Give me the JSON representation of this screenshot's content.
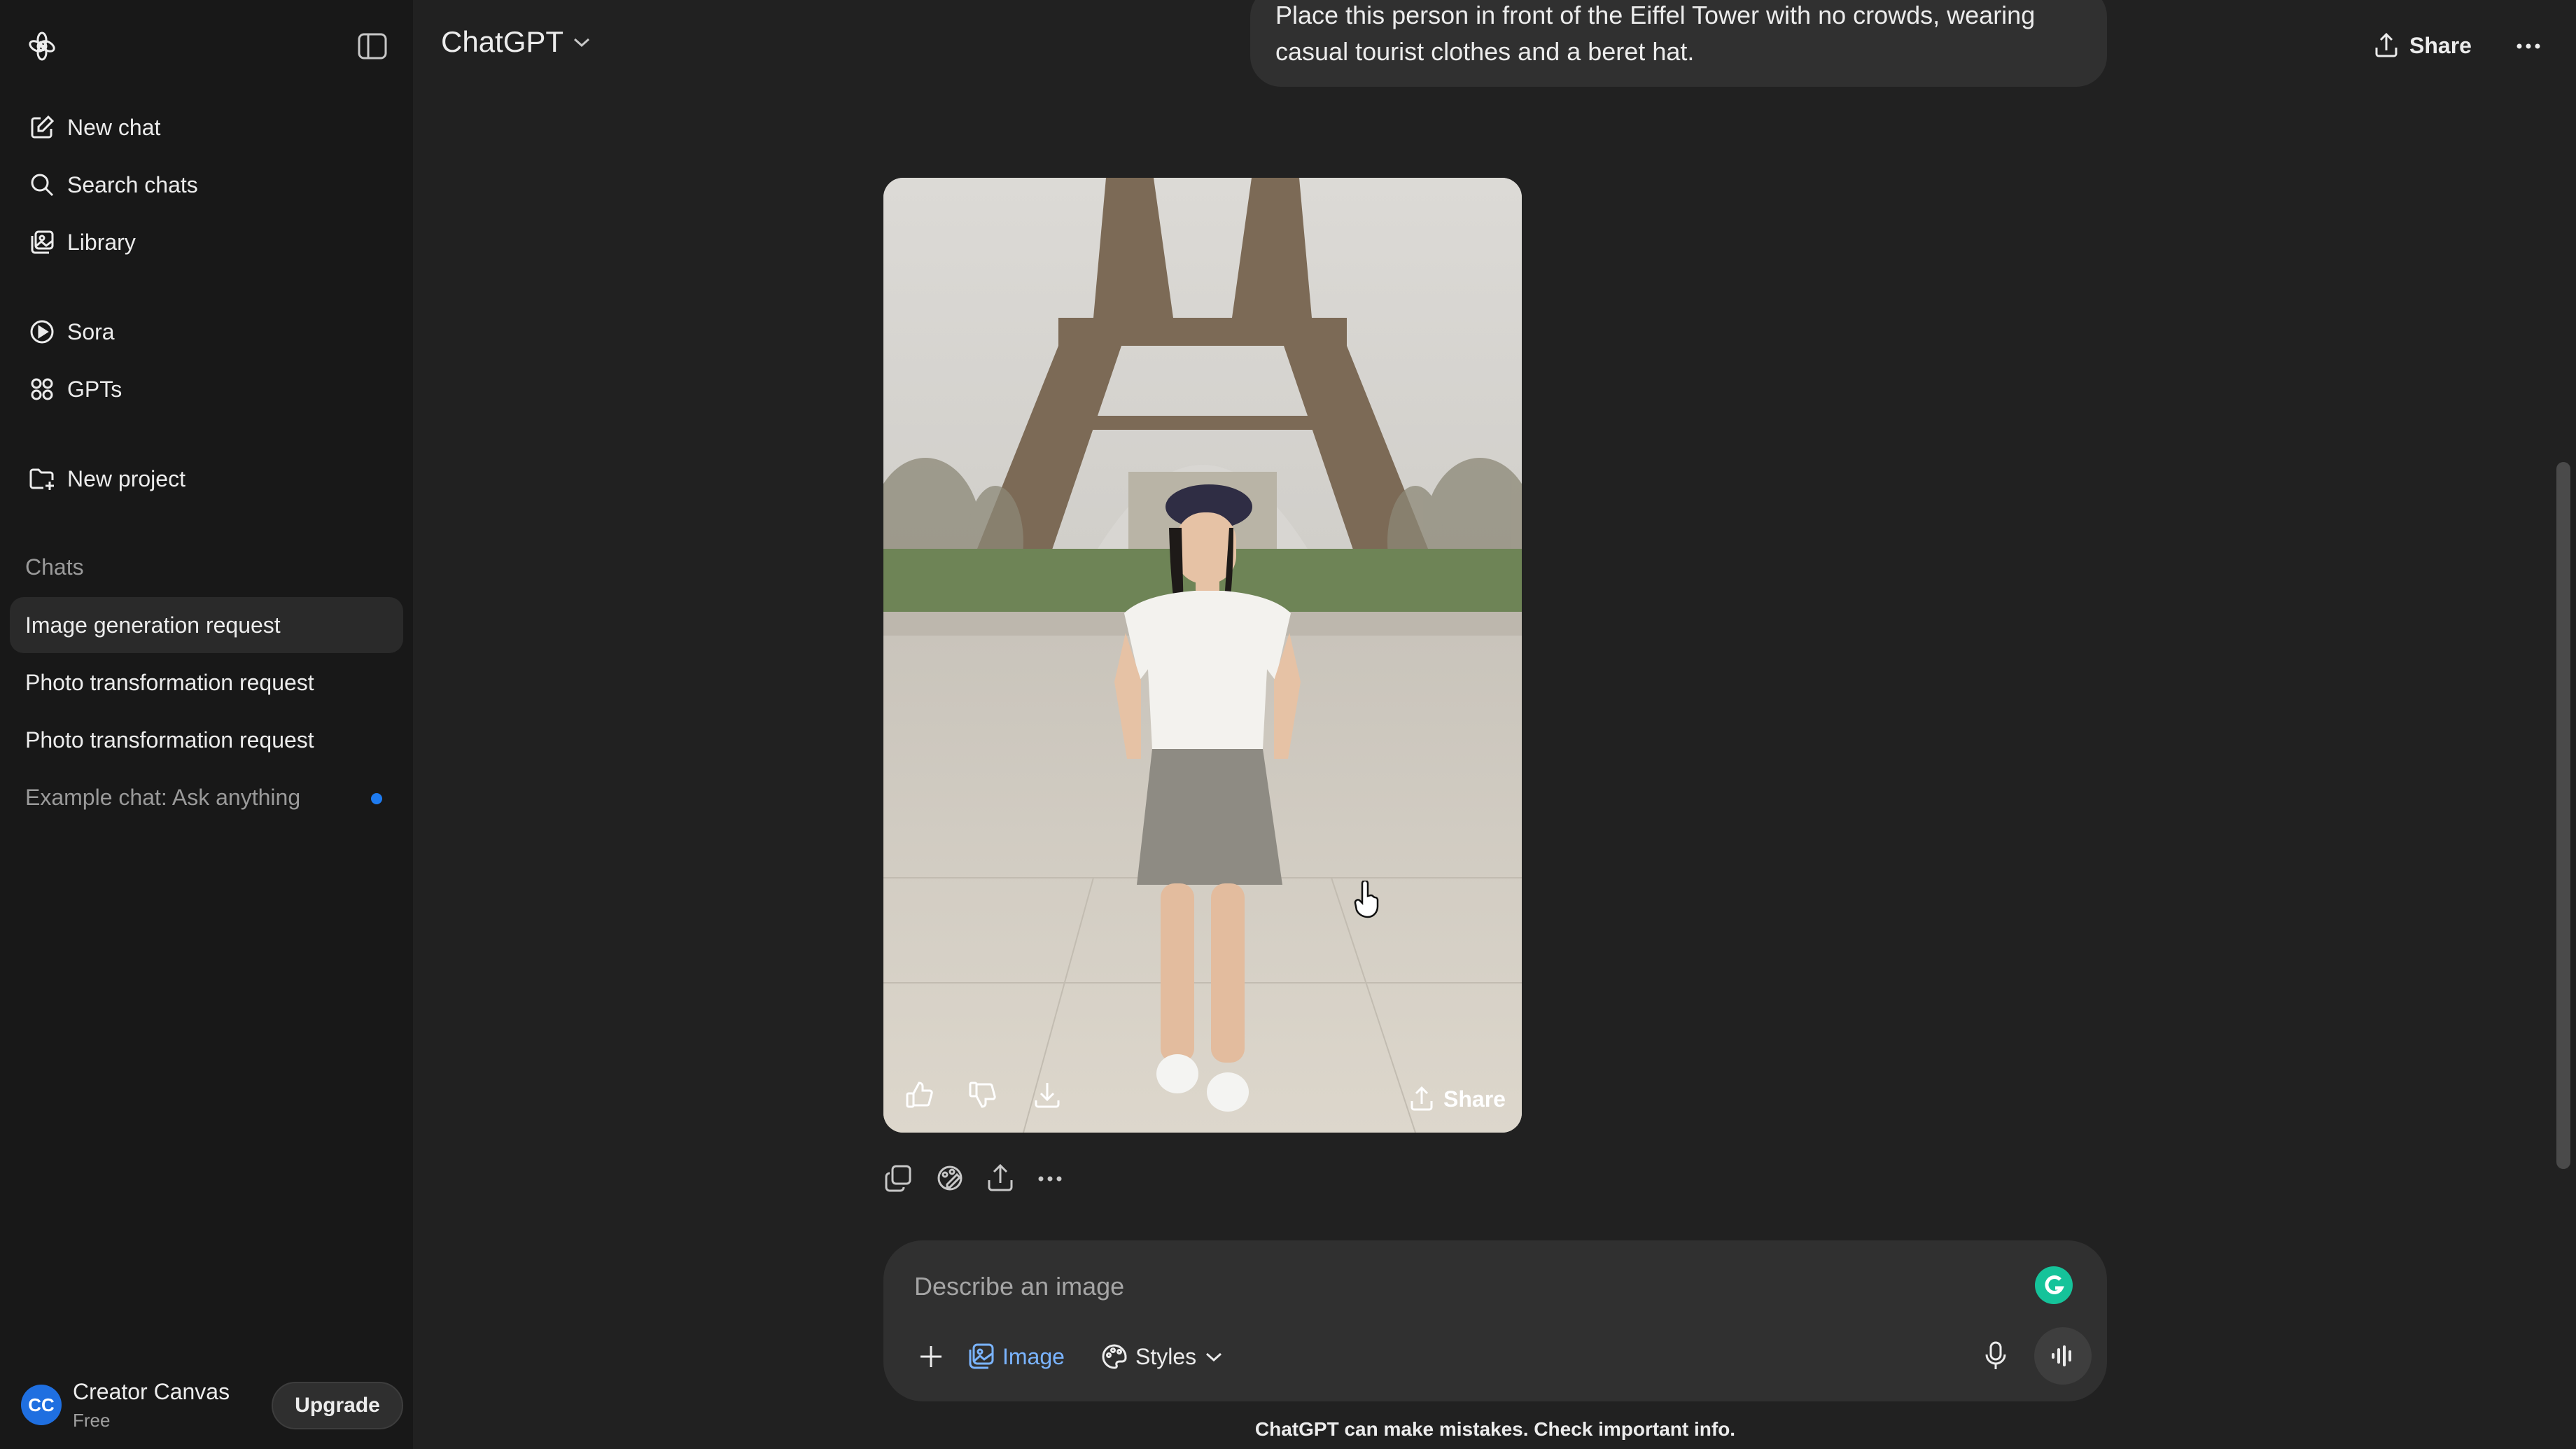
{
  "sidebar": {
    "nav": [
      {
        "label": "New chat",
        "icon": "edit-icon"
      },
      {
        "label": "Search chats",
        "icon": "search-icon"
      },
      {
        "label": "Library",
        "icon": "library-icon"
      },
      {
        "label": "Sora",
        "icon": "play-circle-icon"
      },
      {
        "label": "GPTs",
        "icon": "grid-icon"
      },
      {
        "label": "New project",
        "icon": "folder-plus-icon"
      }
    ],
    "chats_label": "Chats",
    "chats": [
      {
        "title": "Image generation request",
        "active": true
      },
      {
        "title": "Photo transformation request"
      },
      {
        "title": "Photo transformation request"
      },
      {
        "title": "Example chat: Ask anything",
        "unread": true
      }
    ],
    "user": {
      "initials": "CC",
      "name": "Creator Canvas",
      "plan": "Free",
      "upgrade_label": "Upgrade"
    }
  },
  "header": {
    "model": "ChatGPT",
    "share_label": "Share"
  },
  "conversation": {
    "user_message": "Place this person in front of the Eiffel Tower with no crowds, wearing casual tourist clothes and a beret hat.",
    "image_share_label": "Share"
  },
  "composer": {
    "placeholder": "Describe an image",
    "image_label": "Image",
    "styles_label": "Styles"
  },
  "footer": {
    "disclaimer": "ChatGPT can make mistakes. Check important info."
  },
  "colors": {
    "accent": "#7ab4ff",
    "avatar": "#1f6fe0",
    "unread_dot": "#1e7bf0"
  }
}
